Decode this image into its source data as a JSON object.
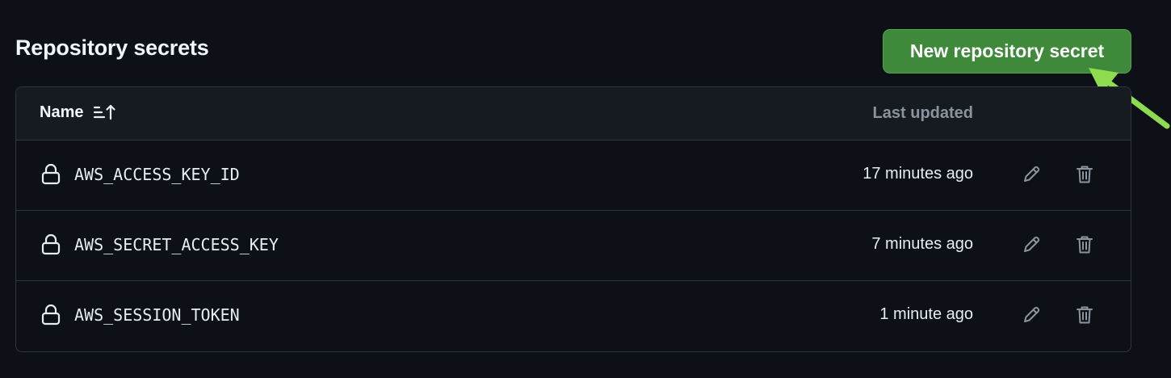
{
  "section": {
    "title": "Repository secrets",
    "new_button_label": "New repository secret"
  },
  "table": {
    "name_header": "Name",
    "updated_header": "Last updated",
    "rows": [
      {
        "name": "AWS_ACCESS_KEY_ID",
        "updated": "17 minutes ago"
      },
      {
        "name": "AWS_SECRET_ACCESS_KEY",
        "updated": "7 minutes ago"
      },
      {
        "name": "AWS_SESSION_TOKEN",
        "updated": "1 minute ago"
      }
    ]
  },
  "icons": {
    "sort": "sort-ascending-icon",
    "lock": "lock-icon",
    "edit": "pencil-icon",
    "delete": "trash-icon",
    "annotation": "arrow-pointer-icon"
  },
  "colors": {
    "background": "#0d1117",
    "header_background": "#161b22",
    "border": "#30363d",
    "button_green": "#3e8a3a",
    "muted_text": "#8b949e",
    "annotation_arrow": "#8fdb4f"
  }
}
